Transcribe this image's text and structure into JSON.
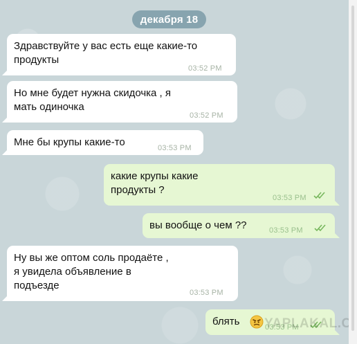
{
  "date_label": "декабря 18",
  "messages": [
    {
      "direction": "in",
      "text": "Здравствуйте у вас есть еще какие-то\nпродукты",
      "time": "03:52 PM"
    },
    {
      "direction": "in",
      "text": "Но мне будет нужна скидочка , я\nмать одиночка",
      "time": "03:52 PM"
    },
    {
      "direction": "in",
      "text": "Мне бы крупы какие-то",
      "time": "03:53 PM"
    },
    {
      "direction": "out",
      "text": "какие крупы какие\nпродукты ?",
      "time": "03:53 PM",
      "read": true
    },
    {
      "direction": "out",
      "text": "вы вообще о чем ??",
      "time": "03:53 PM",
      "read": true
    },
    {
      "direction": "in",
      "text": "Ну вы же оптом соль продаёте ,\nя увидела объявление в\nподъезде",
      "time": "03:53 PM"
    },
    {
      "direction": "out",
      "text": "блять",
      "time": "03:53 PM",
      "read": true,
      "emoji": "angry-emoji"
    }
  ],
  "watermark": "YAPLAKAL.COM",
  "colors": {
    "background": "#c9d6d9",
    "incoming_bubble": "#ffffff",
    "outgoing_bubble": "#e6f7d3",
    "date_pill": "#6e909e",
    "read_check": "#77b75d"
  }
}
